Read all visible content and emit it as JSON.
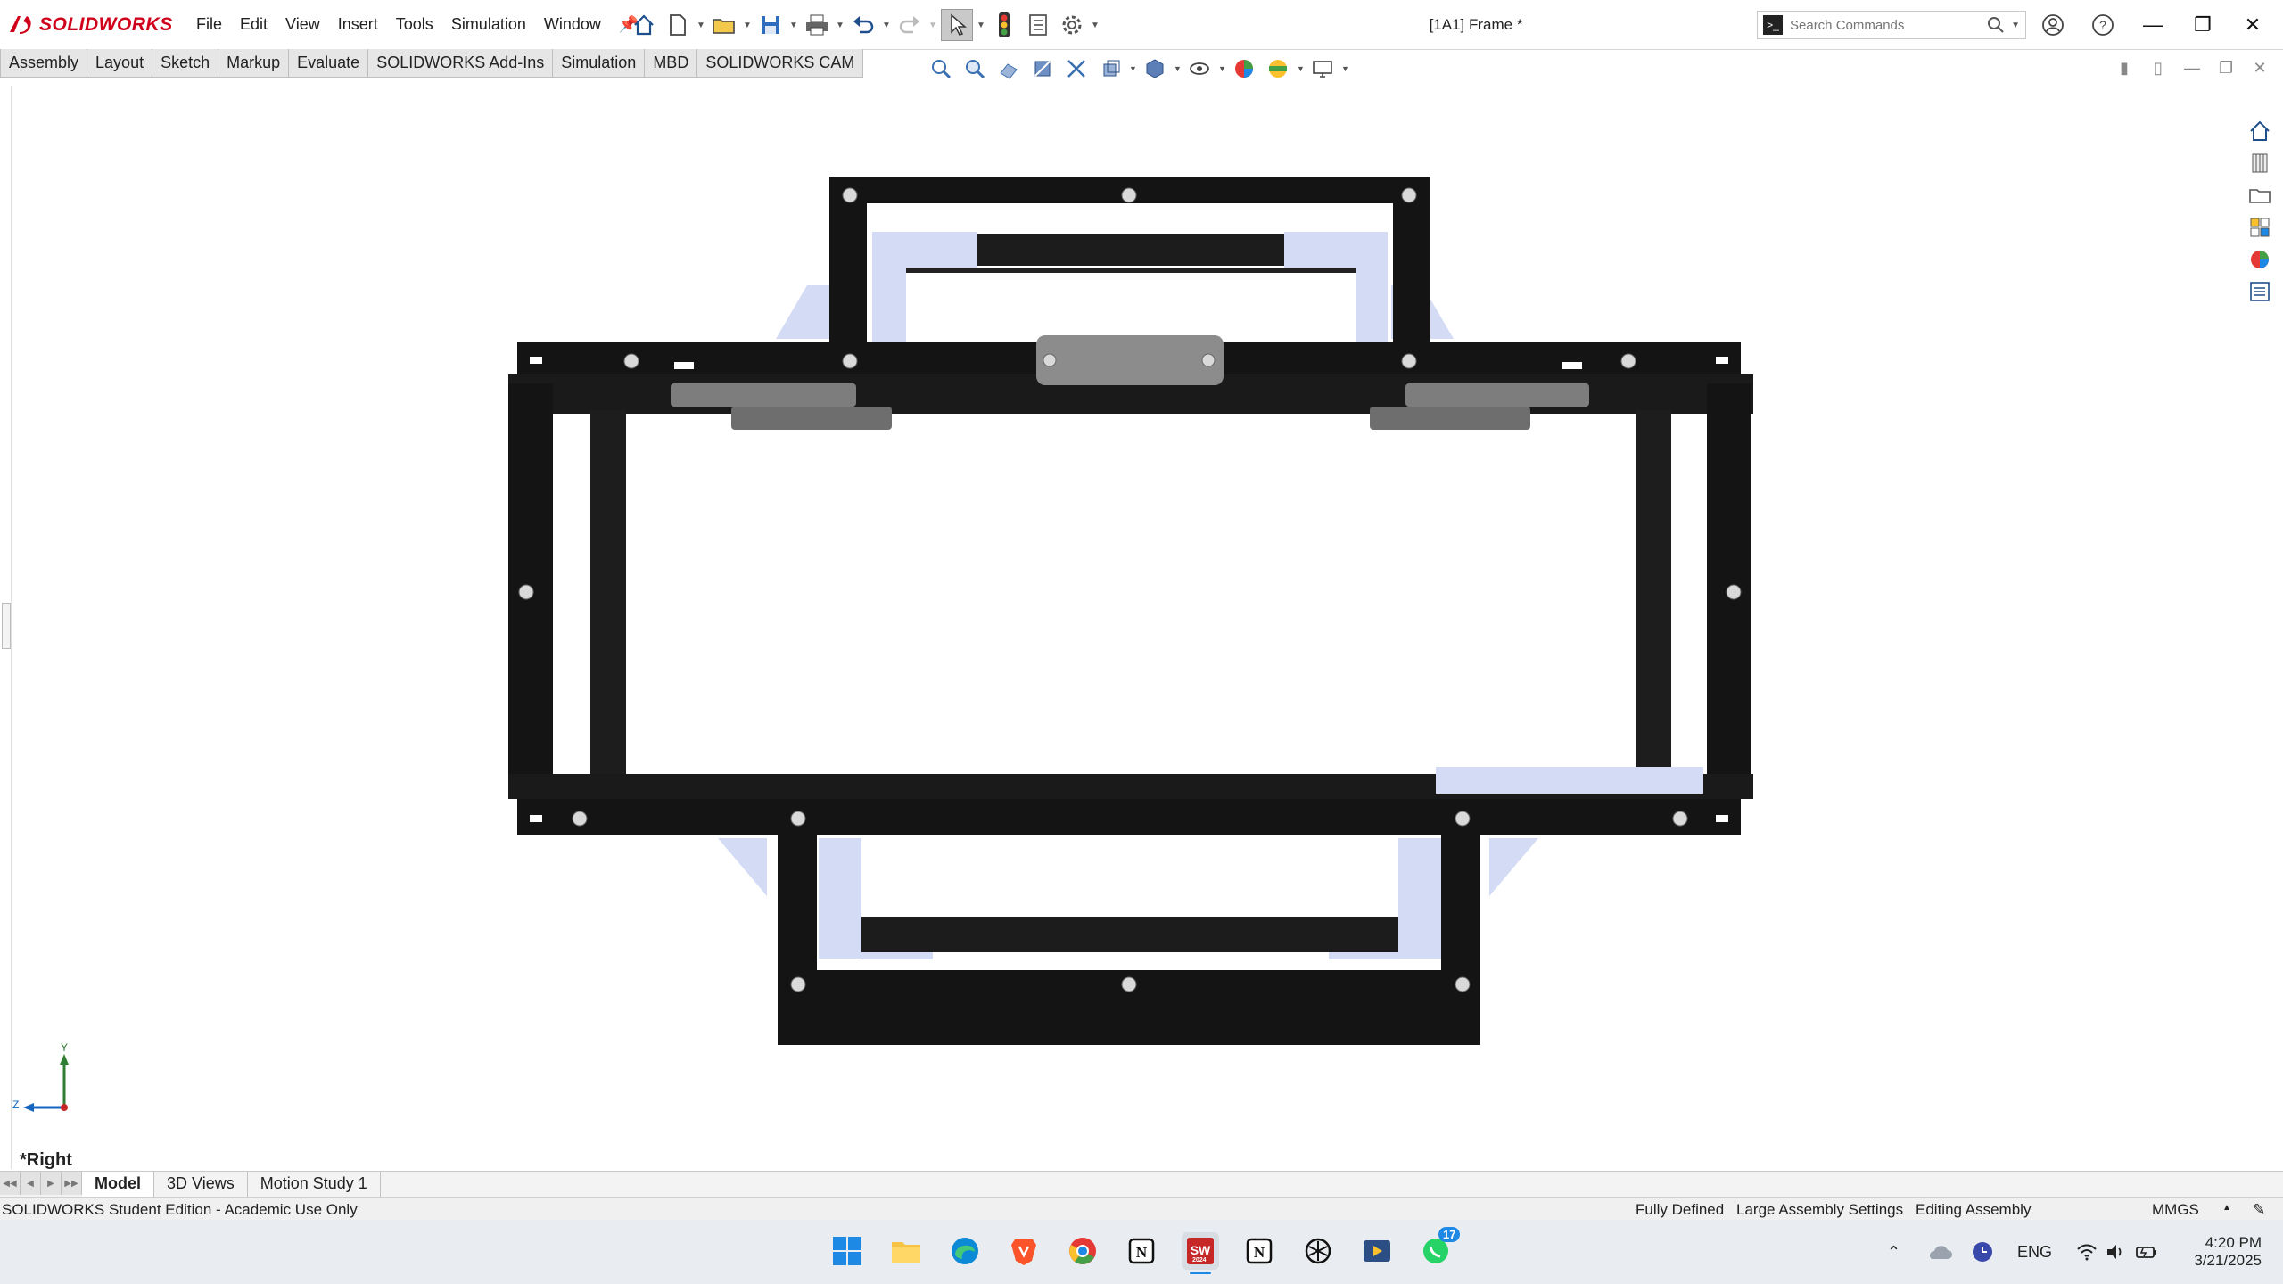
{
  "app": {
    "name": "SOLIDWORKS",
    "document_title": "[1A1] Frame *"
  },
  "menu": [
    "File",
    "Edit",
    "View",
    "Insert",
    "Tools",
    "Simulation",
    "Window"
  ],
  "search": {
    "placeholder": "Search Commands"
  },
  "command_tabs": [
    "Assembly",
    "Layout",
    "Sketch",
    "Markup",
    "Evaluate",
    "SOLIDWORKS Add-Ins",
    "Simulation",
    "MBD",
    "SOLIDWORKS CAM"
  ],
  "viewport": {
    "view_name": "*Right",
    "triad": {
      "y": "Y",
      "z": "Z"
    }
  },
  "bottom_tabs": {
    "items": [
      "Model",
      "3D Views",
      "Motion Study 1"
    ],
    "active": "Model"
  },
  "status": {
    "edition": "SOLIDWORKS Student Edition - Academic Use Only",
    "fully_defined": "Fully Defined",
    "large_assembly": "Large Assembly Settings",
    "editing": "Editing Assembly",
    "units": "MMGS"
  },
  "taskbar": {
    "whatsapp_badge": "17",
    "language": "ENG",
    "time": "4:20 PM",
    "date": "3/21/2025",
    "sw_year": "2024"
  },
  "colors": {
    "brand_red": "#d0021b",
    "frame_black": "#141414",
    "bracket_blue": "#d4dcf5",
    "plate_grey": "#8c8c8c"
  }
}
